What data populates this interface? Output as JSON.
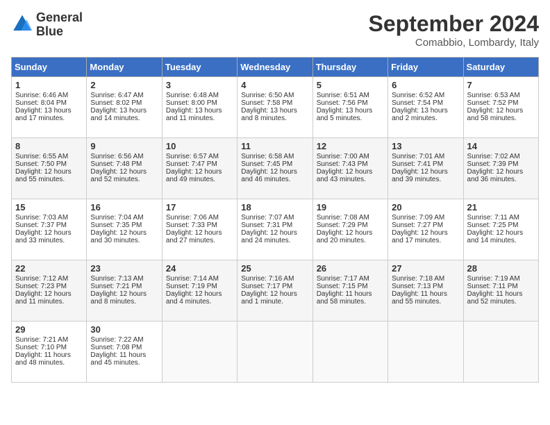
{
  "header": {
    "logo_line1": "General",
    "logo_line2": "Blue",
    "month_title": "September 2024",
    "location": "Comabbio, Lombardy, Italy"
  },
  "weekdays": [
    "Sunday",
    "Monday",
    "Tuesday",
    "Wednesday",
    "Thursday",
    "Friday",
    "Saturday"
  ],
  "weeks": [
    [
      {
        "day": "1",
        "lines": [
          "Sunrise: 6:46 AM",
          "Sunset: 8:04 PM",
          "Daylight: 13 hours",
          "and 17 minutes."
        ]
      },
      {
        "day": "2",
        "lines": [
          "Sunrise: 6:47 AM",
          "Sunset: 8:02 PM",
          "Daylight: 13 hours",
          "and 14 minutes."
        ]
      },
      {
        "day": "3",
        "lines": [
          "Sunrise: 6:48 AM",
          "Sunset: 8:00 PM",
          "Daylight: 13 hours",
          "and 11 minutes."
        ]
      },
      {
        "day": "4",
        "lines": [
          "Sunrise: 6:50 AM",
          "Sunset: 7:58 PM",
          "Daylight: 13 hours",
          "and 8 minutes."
        ]
      },
      {
        "day": "5",
        "lines": [
          "Sunrise: 6:51 AM",
          "Sunset: 7:56 PM",
          "Daylight: 13 hours",
          "and 5 minutes."
        ]
      },
      {
        "day": "6",
        "lines": [
          "Sunrise: 6:52 AM",
          "Sunset: 7:54 PM",
          "Daylight: 13 hours",
          "and 2 minutes."
        ]
      },
      {
        "day": "7",
        "lines": [
          "Sunrise: 6:53 AM",
          "Sunset: 7:52 PM",
          "Daylight: 12 hours",
          "and 58 minutes."
        ]
      }
    ],
    [
      {
        "day": "8",
        "lines": [
          "Sunrise: 6:55 AM",
          "Sunset: 7:50 PM",
          "Daylight: 12 hours",
          "and 55 minutes."
        ]
      },
      {
        "day": "9",
        "lines": [
          "Sunrise: 6:56 AM",
          "Sunset: 7:48 PM",
          "Daylight: 12 hours",
          "and 52 minutes."
        ]
      },
      {
        "day": "10",
        "lines": [
          "Sunrise: 6:57 AM",
          "Sunset: 7:47 PM",
          "Daylight: 12 hours",
          "and 49 minutes."
        ]
      },
      {
        "day": "11",
        "lines": [
          "Sunrise: 6:58 AM",
          "Sunset: 7:45 PM",
          "Daylight: 12 hours",
          "and 46 minutes."
        ]
      },
      {
        "day": "12",
        "lines": [
          "Sunrise: 7:00 AM",
          "Sunset: 7:43 PM",
          "Daylight: 12 hours",
          "and 43 minutes."
        ]
      },
      {
        "day": "13",
        "lines": [
          "Sunrise: 7:01 AM",
          "Sunset: 7:41 PM",
          "Daylight: 12 hours",
          "and 39 minutes."
        ]
      },
      {
        "day": "14",
        "lines": [
          "Sunrise: 7:02 AM",
          "Sunset: 7:39 PM",
          "Daylight: 12 hours",
          "and 36 minutes."
        ]
      }
    ],
    [
      {
        "day": "15",
        "lines": [
          "Sunrise: 7:03 AM",
          "Sunset: 7:37 PM",
          "Daylight: 12 hours",
          "and 33 minutes."
        ]
      },
      {
        "day": "16",
        "lines": [
          "Sunrise: 7:04 AM",
          "Sunset: 7:35 PM",
          "Daylight: 12 hours",
          "and 30 minutes."
        ]
      },
      {
        "day": "17",
        "lines": [
          "Sunrise: 7:06 AM",
          "Sunset: 7:33 PM",
          "Daylight: 12 hours",
          "and 27 minutes."
        ]
      },
      {
        "day": "18",
        "lines": [
          "Sunrise: 7:07 AM",
          "Sunset: 7:31 PM",
          "Daylight: 12 hours",
          "and 24 minutes."
        ]
      },
      {
        "day": "19",
        "lines": [
          "Sunrise: 7:08 AM",
          "Sunset: 7:29 PM",
          "Daylight: 12 hours",
          "and 20 minutes."
        ]
      },
      {
        "day": "20",
        "lines": [
          "Sunrise: 7:09 AM",
          "Sunset: 7:27 PM",
          "Daylight: 12 hours",
          "and 17 minutes."
        ]
      },
      {
        "day": "21",
        "lines": [
          "Sunrise: 7:11 AM",
          "Sunset: 7:25 PM",
          "Daylight: 12 hours",
          "and 14 minutes."
        ]
      }
    ],
    [
      {
        "day": "22",
        "lines": [
          "Sunrise: 7:12 AM",
          "Sunset: 7:23 PM",
          "Daylight: 12 hours",
          "and 11 minutes."
        ]
      },
      {
        "day": "23",
        "lines": [
          "Sunrise: 7:13 AM",
          "Sunset: 7:21 PM",
          "Daylight: 12 hours",
          "and 8 minutes."
        ]
      },
      {
        "day": "24",
        "lines": [
          "Sunrise: 7:14 AM",
          "Sunset: 7:19 PM",
          "Daylight: 12 hours",
          "and 4 minutes."
        ]
      },
      {
        "day": "25",
        "lines": [
          "Sunrise: 7:16 AM",
          "Sunset: 7:17 PM",
          "Daylight: 12 hours",
          "and 1 minute."
        ]
      },
      {
        "day": "26",
        "lines": [
          "Sunrise: 7:17 AM",
          "Sunset: 7:15 PM",
          "Daylight: 11 hours",
          "and 58 minutes."
        ]
      },
      {
        "day": "27",
        "lines": [
          "Sunrise: 7:18 AM",
          "Sunset: 7:13 PM",
          "Daylight: 11 hours",
          "and 55 minutes."
        ]
      },
      {
        "day": "28",
        "lines": [
          "Sunrise: 7:19 AM",
          "Sunset: 7:11 PM",
          "Daylight: 11 hours",
          "and 52 minutes."
        ]
      }
    ],
    [
      {
        "day": "29",
        "lines": [
          "Sunrise: 7:21 AM",
          "Sunset: 7:10 PM",
          "Daylight: 11 hours",
          "and 48 minutes."
        ]
      },
      {
        "day": "30",
        "lines": [
          "Sunrise: 7:22 AM",
          "Sunset: 7:08 PM",
          "Daylight: 11 hours",
          "and 45 minutes."
        ]
      },
      {
        "day": "",
        "lines": []
      },
      {
        "day": "",
        "lines": []
      },
      {
        "day": "",
        "lines": []
      },
      {
        "day": "",
        "lines": []
      },
      {
        "day": "",
        "lines": []
      }
    ]
  ]
}
